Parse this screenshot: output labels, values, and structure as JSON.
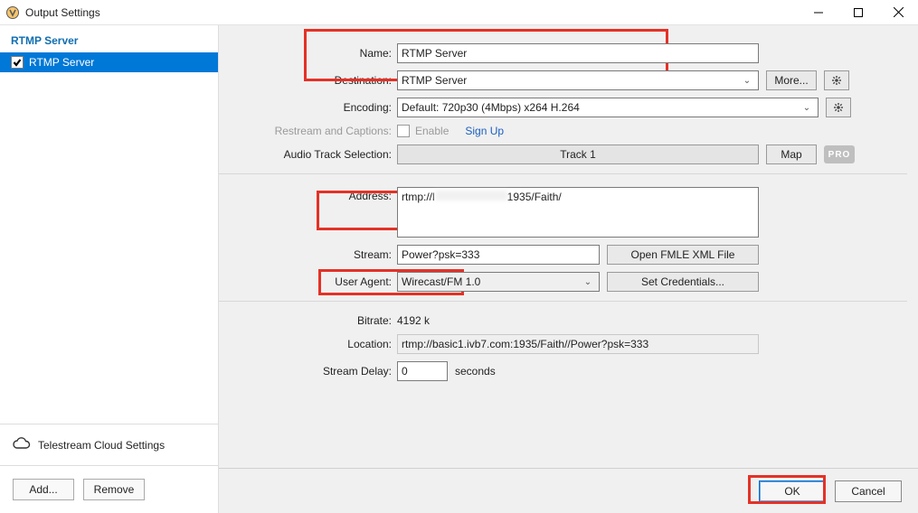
{
  "window": {
    "title": "Output Settings"
  },
  "sidebar": {
    "heading": "RTMP Server",
    "item_label": "RTMP Server",
    "cloud": "Telestream Cloud Settings",
    "add_btn": "Add...",
    "remove_btn": "Remove"
  },
  "form": {
    "name": {
      "label": "Name:",
      "value": "RTMP Server"
    },
    "destination": {
      "label": "Destination:",
      "value": "RTMP Server",
      "more_btn": "More..."
    },
    "encoding": {
      "label": "Encoding:",
      "value": "Default: 720p30 (4Mbps) x264 H.264"
    },
    "restream": {
      "label": "Restream and Captions:",
      "enable": "Enable",
      "signup": "Sign Up"
    },
    "audio_track": {
      "label": "Audio Track Selection:",
      "value": "Track 1",
      "map_btn": "Map",
      "pro": "PRO"
    },
    "address": {
      "label": "Address:",
      "prefix": "rtmp://l",
      "suffix": "1935/Faith/"
    },
    "stream": {
      "label": "Stream:",
      "value": "Power?psk=333",
      "open_btn": "Open FMLE XML File"
    },
    "user_agent": {
      "label": "User Agent:",
      "value": "Wirecast/FM 1.0",
      "creds_btn": "Set Credentials..."
    },
    "bitrate": {
      "label": "Bitrate:",
      "value": "4192 k"
    },
    "location": {
      "label": "Location:",
      "value": "rtmp://basic1.ivb7.com:1935/Faith//Power?psk=333"
    },
    "stream_delay": {
      "label": "Stream Delay:",
      "value": "0",
      "unit": "seconds"
    }
  },
  "footer": {
    "ok": "OK",
    "cancel": "Cancel"
  }
}
